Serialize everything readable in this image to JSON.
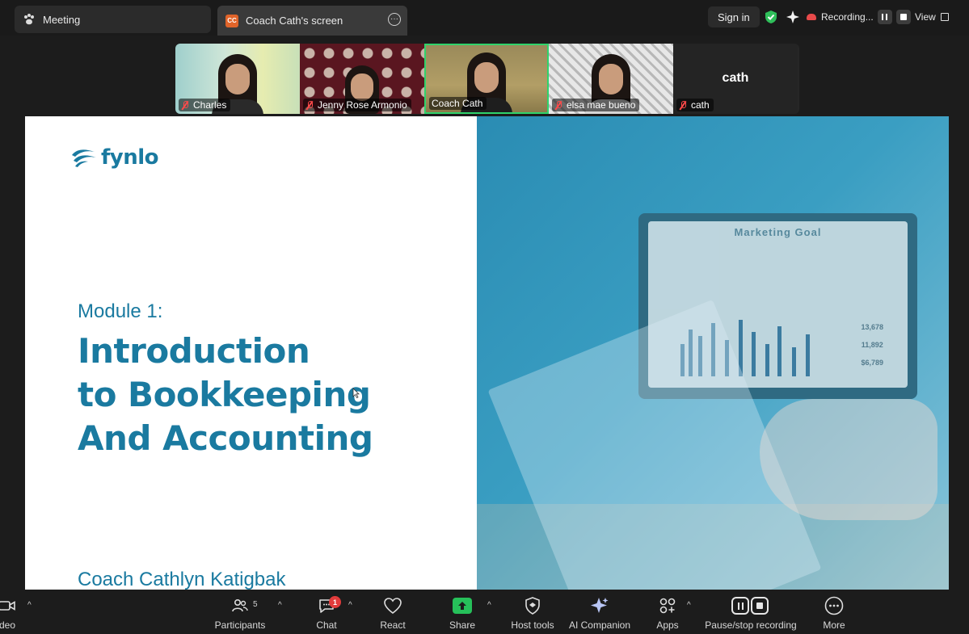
{
  "tabs": {
    "meeting": "Meeting",
    "screen_badge": "CC",
    "screen": "Coach Cath's screen"
  },
  "header": {
    "sign_in": "Sign in",
    "recording": "Recording...",
    "view": "View"
  },
  "participants": [
    {
      "name": "Charles"
    },
    {
      "name": "Jenny Rose Armonio"
    },
    {
      "name": "Coach Cath",
      "speaking": true
    },
    {
      "name": "elsa mae bueno"
    },
    {
      "name": "cath",
      "video_off_label": "cath"
    }
  ],
  "slide": {
    "logo": "fynlo",
    "module": "Module 1:",
    "title_lines": [
      "Introduction",
      "to Bookkeeping",
      "And Accounting"
    ],
    "presenter": "Coach Cathlyn Katigbak",
    "image": {
      "screen_title": "Marketing Goal",
      "stats": [
        "13,678",
        "11,892",
        "$6,789"
      ]
    }
  },
  "toolbar": {
    "video": "deo",
    "participants": "Participants",
    "participants_count": "5",
    "chat": "Chat",
    "chat_badge": "1",
    "react": "React",
    "share": "Share",
    "host_tools": "Host tools",
    "ai_companion": "AI Companion",
    "apps": "Apps",
    "pause_stop": "Pause/stop recording",
    "more": "More"
  },
  "colors": {
    "brand": "#1a7aa0",
    "share_green": "#26c05a",
    "speaking_border": "#2fd36b",
    "muted_red": "#ff4a4a",
    "badge_red": "#e23b3b"
  }
}
